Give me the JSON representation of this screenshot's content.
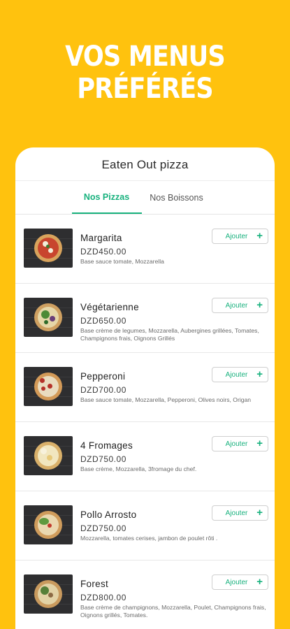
{
  "banner": {
    "line1": "VOS MENUS",
    "line2": "PRÉFÉRÉS"
  },
  "store": {
    "title": "Eaten Out pizza"
  },
  "tabs": [
    {
      "label": "Nos Pizzas",
      "active": true
    },
    {
      "label": "Nos Boissons",
      "active": false
    }
  ],
  "add_label": "Ajouter",
  "add_icon": "plus-icon",
  "colors": {
    "background": "#FFC20E",
    "accent": "#17B17D"
  },
  "items": [
    {
      "name": "Margarita",
      "price": "DZD450.00",
      "description": "Base sauce tomate, Mozzarella"
    },
    {
      "name": "Végétarienne",
      "price": "DZD650.00",
      "description": "Base crème de legumes, Mozzarella, Aubergines grillées, Tomates, Champignons frais, Oignons Grillés"
    },
    {
      "name": "Pepperoni",
      "price": "DZD700.00",
      "description": "Base sauce tomate, Mozzarella, Pepperoni, Olives noirs, Origan"
    },
    {
      "name": "4 Fromages",
      "price": "DZD750.00",
      "description": "Base crème, Mozzarella, 3fromage du chef."
    },
    {
      "name": "Pollo Arrosto",
      "price": "DZD750.00",
      "description": "Mozzarella, tomates cerises, jambon de poulet rôti ."
    },
    {
      "name": "Forest",
      "price": "DZD800.00",
      "description": "Base crème de champignons, Mozzarella, Poulet, Champignons frais, Oignons grillés, Tomates."
    }
  ]
}
